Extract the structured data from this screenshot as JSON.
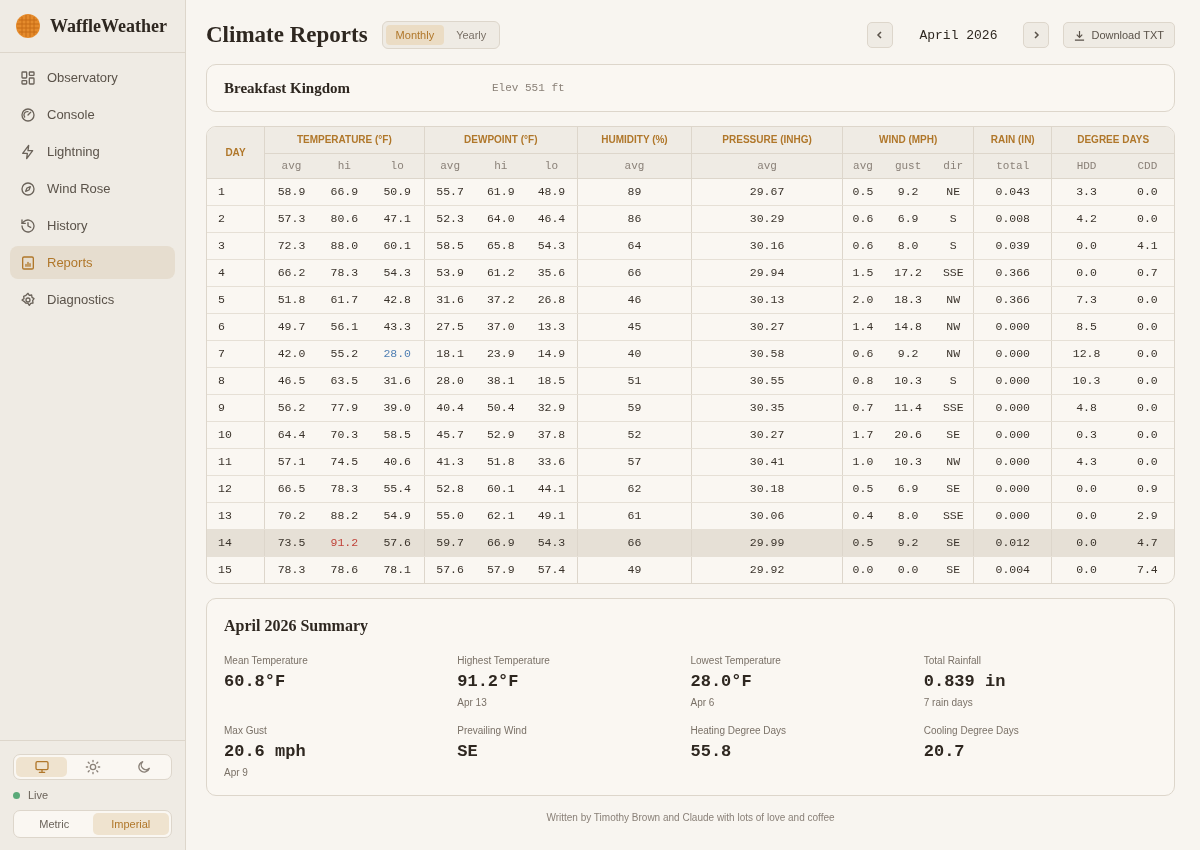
{
  "app": {
    "name": "WaffleWeather"
  },
  "nav": [
    {
      "label": "Observatory",
      "kind": "grid",
      "selected": false
    },
    {
      "label": "Console",
      "kind": "gauge",
      "selected": false
    },
    {
      "label": "Lightning",
      "kind": "bolt",
      "selected": false
    },
    {
      "label": "Wind Rose",
      "kind": "compass",
      "selected": false
    },
    {
      "label": "History",
      "kind": "history",
      "selected": false
    },
    {
      "label": "Reports",
      "kind": "report",
      "selected": true
    },
    {
      "label": "Diagnostics",
      "kind": "gear",
      "selected": false
    }
  ],
  "theme_toggle": [
    {
      "kind": "monitor",
      "selected": true
    },
    {
      "kind": "sun",
      "selected": false
    },
    {
      "kind": "moon",
      "selected": false
    }
  ],
  "status": {
    "label": "Live",
    "online": true
  },
  "units": [
    {
      "label": "Metric",
      "selected": false
    },
    {
      "label": "Imperial",
      "selected": true
    }
  ],
  "page": {
    "title": "Climate Reports"
  },
  "period_tabs": [
    {
      "label": "Monthly",
      "selected": true
    },
    {
      "label": "Yearly",
      "selected": false
    }
  ],
  "period": {
    "label": "April 2026"
  },
  "download_button": {
    "label": "Download TXT"
  },
  "station": {
    "name": "Breakfast Kingdom",
    "elevation": "Elev 551 ft"
  },
  "table": {
    "day_header": "DAY",
    "groups": [
      {
        "label": "TEMPERATURE (°F)",
        "columns": [
          "avg",
          "hi",
          "lo"
        ]
      },
      {
        "label": "DEWPOINT (°F)",
        "columns": [
          "avg",
          "hi",
          "lo"
        ]
      },
      {
        "label": "HUMIDITY (%)",
        "columns": [
          "avg"
        ]
      },
      {
        "label": "PRESSURE (INHG)",
        "columns": [
          "avg"
        ]
      },
      {
        "label": "WIND (MPH)",
        "columns": [
          "avg",
          "gust",
          "dir"
        ]
      },
      {
        "label": "RAIN (IN)",
        "columns": [
          "total"
        ]
      },
      {
        "label": "DEGREE DAYS",
        "columns": [
          "HDD",
          "CDD"
        ]
      }
    ],
    "rows": [
      {
        "day": "1",
        "values": [
          "58.9",
          "66.9",
          "50.9",
          "55.7",
          "61.9",
          "48.9",
          "89",
          "29.67",
          "0.5",
          "9.2",
          "NE",
          "0.043",
          "3.3",
          "0.0"
        ],
        "selected": false,
        "hi_record": false,
        "lo_record": false
      },
      {
        "day": "2",
        "values": [
          "57.3",
          "80.6",
          "47.1",
          "52.3",
          "64.0",
          "46.4",
          "86",
          "30.29",
          "0.6",
          "6.9",
          "S",
          "0.008",
          "4.2",
          "0.0"
        ],
        "selected": false,
        "hi_record": false,
        "lo_record": false
      },
      {
        "day": "3",
        "values": [
          "72.3",
          "88.0",
          "60.1",
          "58.5",
          "65.8",
          "54.3",
          "64",
          "30.16",
          "0.6",
          "8.0",
          "S",
          "0.039",
          "0.0",
          "4.1"
        ],
        "selected": false,
        "hi_record": false,
        "lo_record": false
      },
      {
        "day": "4",
        "values": [
          "66.2",
          "78.3",
          "54.3",
          "53.9",
          "61.2",
          "35.6",
          "66",
          "29.94",
          "1.5",
          "17.2",
          "SSE",
          "0.366",
          "0.0",
          "0.7"
        ],
        "selected": false,
        "hi_record": false,
        "lo_record": false
      },
      {
        "day": "5",
        "values": [
          "51.8",
          "61.7",
          "42.8",
          "31.6",
          "37.2",
          "26.8",
          "46",
          "30.13",
          "2.0",
          "18.3",
          "NW",
          "0.366",
          "7.3",
          "0.0"
        ],
        "selected": false,
        "hi_record": false,
        "lo_record": false
      },
      {
        "day": "6",
        "values": [
          "49.7",
          "56.1",
          "43.3",
          "27.5",
          "37.0",
          "13.3",
          "45",
          "30.27",
          "1.4",
          "14.8",
          "NW",
          "0.000",
          "8.5",
          "0.0"
        ],
        "selected": false,
        "hi_record": false,
        "lo_record": false
      },
      {
        "day": "7",
        "values": [
          "42.0",
          "55.2",
          "28.0",
          "18.1",
          "23.9",
          "14.9",
          "40",
          "30.58",
          "0.6",
          "9.2",
          "NW",
          "0.000",
          "12.8",
          "0.0"
        ],
        "selected": false,
        "hi_record": false,
        "lo_record": true
      },
      {
        "day": "8",
        "values": [
          "46.5",
          "63.5",
          "31.6",
          "28.0",
          "38.1",
          "18.5",
          "51",
          "30.55",
          "0.8",
          "10.3",
          "S",
          "0.000",
          "10.3",
          "0.0"
        ],
        "selected": false,
        "hi_record": false,
        "lo_record": false
      },
      {
        "day": "9",
        "values": [
          "56.2",
          "77.9",
          "39.0",
          "40.4",
          "50.4",
          "32.9",
          "59",
          "30.35",
          "0.7",
          "11.4",
          "SSE",
          "0.000",
          "4.8",
          "0.0"
        ],
        "selected": false,
        "hi_record": false,
        "lo_record": false
      },
      {
        "day": "10",
        "values": [
          "64.4",
          "70.3",
          "58.5",
          "45.7",
          "52.9",
          "37.8",
          "52",
          "30.27",
          "1.7",
          "20.6",
          "SE",
          "0.000",
          "0.3",
          "0.0"
        ],
        "selected": false,
        "hi_record": false,
        "lo_record": false
      },
      {
        "day": "11",
        "values": [
          "57.1",
          "74.5",
          "40.6",
          "41.3",
          "51.8",
          "33.6",
          "57",
          "30.41",
          "1.0",
          "10.3",
          "NW",
          "0.000",
          "4.3",
          "0.0"
        ],
        "selected": false,
        "hi_record": false,
        "lo_record": false
      },
      {
        "day": "12",
        "values": [
          "66.5",
          "78.3",
          "55.4",
          "52.8",
          "60.1",
          "44.1",
          "62",
          "30.18",
          "0.5",
          "6.9",
          "SE",
          "0.000",
          "0.0",
          "0.9"
        ],
        "selected": false,
        "hi_record": false,
        "lo_record": false
      },
      {
        "day": "13",
        "values": [
          "70.2",
          "88.2",
          "54.9",
          "55.0",
          "62.1",
          "49.1",
          "61",
          "30.06",
          "0.4",
          "8.0",
          "SSE",
          "0.000",
          "0.0",
          "2.9"
        ],
        "selected": false,
        "hi_record": false,
        "lo_record": false
      },
      {
        "day": "14",
        "values": [
          "73.5",
          "91.2",
          "57.6",
          "59.7",
          "66.9",
          "54.3",
          "66",
          "29.99",
          "0.5",
          "9.2",
          "SE",
          "0.012",
          "0.0",
          "4.7"
        ],
        "selected": true,
        "hi_record": true,
        "lo_record": false
      },
      {
        "day": "15",
        "values": [
          "78.3",
          "78.6",
          "78.1",
          "57.6",
          "57.9",
          "57.4",
          "49",
          "29.92",
          "0.0",
          "0.0",
          "SE",
          "0.004",
          "0.0",
          "7.4"
        ],
        "selected": false,
        "hi_record": false,
        "lo_record": false
      }
    ]
  },
  "summary": {
    "title": "April 2026 Summary",
    "stats": [
      {
        "label": "Mean Temperature",
        "value": "60.8°F"
      },
      {
        "label": "Highest Temperature",
        "value": "91.2°F",
        "note": "Apr 13"
      },
      {
        "label": "Lowest Temperature",
        "value": "28.0°F",
        "note": "Apr 6"
      },
      {
        "label": "Total Rainfall",
        "value": "0.839 in",
        "note": "7 rain days"
      },
      {
        "label": "Max Gust",
        "value": "20.6 mph",
        "note": "Apr 9"
      },
      {
        "label": "Prevailing Wind",
        "value": "SE"
      },
      {
        "label": "Heating Degree Days",
        "value": "55.8"
      },
      {
        "label": "Cooling Degree Days",
        "value": "20.7"
      }
    ]
  },
  "footer": {
    "text": "Written by Timothy Brown and Claude with lots of love and coffee"
  }
}
